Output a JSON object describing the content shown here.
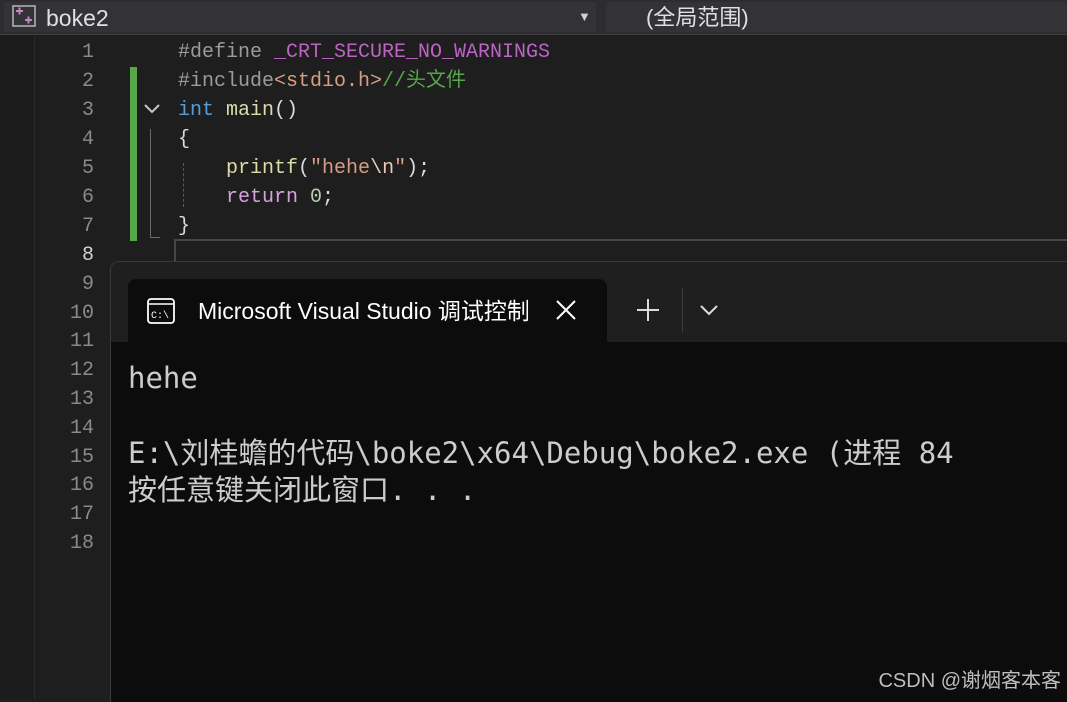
{
  "navbar": {
    "project_name": "boke2",
    "scope": "(全局范围)"
  },
  "editor": {
    "line_numbers": [
      "1",
      "2",
      "3",
      "4",
      "5",
      "6",
      "7",
      "8",
      "9",
      "10",
      "11",
      "12",
      "13",
      "14",
      "15",
      "16",
      "17",
      "18"
    ],
    "code": {
      "l1_directive": "#define",
      "l1_macro": " _CRT_SECURE_NO_WARNINGS",
      "l2_directive": "#include",
      "l2_header": "<stdio.h>",
      "l2_comment": "//头文件",
      "l3_type": "int",
      "l3_name": " main",
      "l3_parens": "()",
      "l4_brace": "{",
      "l5_fn": "printf",
      "l5_open": "(",
      "l5_str": "\"hehe",
      "l5_esc": "\\n",
      "l5_strend": "\"",
      "l5_close": ");",
      "l6_kw": "return",
      "l6_num": " 0",
      "l6_semi": ";",
      "l7_brace": "}"
    }
  },
  "terminal": {
    "tab_title": "Microsoft Visual Studio 调试控制台",
    "output": [
      "hehe",
      "",
      "E:\\刘桂蟾的代码\\boke2\\x64\\Debug\\boke2.exe (进程 84",
      "按任意键关闭此窗口. . ."
    ]
  },
  "watermark": "CSDN @谢烟客本客",
  "colors": {
    "keyword": "#569cd6",
    "function": "#dcdcaa",
    "string": "#d69d85",
    "comment": "#57a64a",
    "macro": "#bd63c5",
    "change_bar": "#57a64a",
    "terminal_bg": "#0c0c0c"
  }
}
